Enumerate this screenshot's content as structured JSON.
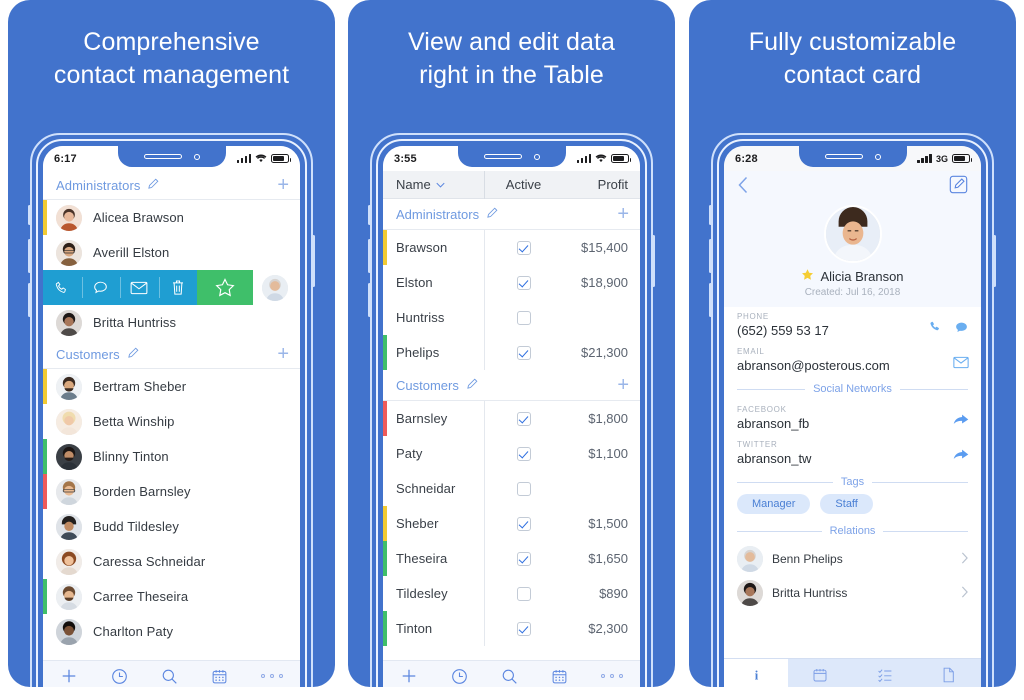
{
  "theme": {
    "panel_blue": "#4273cc",
    "accent_blue": "#4a7fd4",
    "swipe_blue": "#1f9ed2",
    "swipe_green": "#3fbf6a",
    "strip_yellow": "#f2cb33",
    "strip_green": "#3fbf6a",
    "strip_red": "#ee5a5a"
  },
  "panels": [
    {
      "id": "panel-1",
      "headline": "Comprehensive\ncontact management",
      "headline_line1": "Comprehensive",
      "headline_line2": "contact management",
      "status": {
        "time": "6:17",
        "carrier": "",
        "wifi": true
      },
      "groups": [
        {
          "label": "Administrators",
          "edit_icon": "pencil-icon",
          "add_icon": "plus-icon"
        },
        {
          "label": "Customers",
          "edit_icon": "pencil-icon",
          "add_icon": "plus-icon"
        }
      ],
      "contacts_admins": [
        {
          "name": "Alicea Brawson",
          "strip": "#f2cb33",
          "avatar": "woman-1"
        },
        {
          "name": "Averill Elston",
          "strip": "",
          "avatar": "woman-glasses"
        },
        {
          "name": "Britta Huntriss",
          "strip": "",
          "avatar": "woman-2"
        }
      ],
      "swipe_row": {
        "actions": [
          "phone-icon",
          "chat-icon",
          "mail-icon",
          "trash-icon",
          "star-icon"
        ],
        "avatar": "man-senior"
      },
      "contacts_customers": [
        {
          "name": "Bertram Sheber",
          "strip": "#f2cb33",
          "avatar": "man-beard"
        },
        {
          "name": "Betta Winship",
          "strip": "",
          "avatar": "woman-blonde"
        },
        {
          "name": "Blinny Tinton",
          "strip": "#3fbf6a",
          "avatar": "man-dark"
        },
        {
          "name": "Borden Barnsley",
          "strip": "#ee5a5a",
          "avatar": "man-glasses"
        },
        {
          "name": "Budd Tildesley",
          "strip": "",
          "avatar": "man-cap"
        },
        {
          "name": "Caressa Schneidar",
          "strip": "",
          "avatar": "woman-red"
        },
        {
          "name": "Carree Theseira",
          "strip": "#3fbf6a",
          "avatar": "man-young"
        },
        {
          "name": "Charlton Paty",
          "strip": "",
          "avatar": "man-dark2"
        }
      ],
      "toolbar": [
        "plus-icon",
        "recent-clock-icon",
        "search-icon",
        "calendar-icon",
        "more-dots-icon"
      ]
    },
    {
      "id": "panel-2",
      "headline_line1": "View and edit data",
      "headline_line2": "right in the Table",
      "status": {
        "time": "3:55",
        "carrier": "",
        "wifi": true
      },
      "toolbar": [
        "plus-icon",
        "recent-clock-icon",
        "search-icon",
        "calendar-icon",
        "more-dots-icon"
      ]
    },
    {
      "id": "panel-3",
      "headline_line1": "Fully customizable",
      "headline_line2": "contact card",
      "status": {
        "time": "6:28",
        "carrier": "3G",
        "wifi": false
      },
      "nav": {
        "back_icon": "chevron-left-icon",
        "edit_icon": "edit-square-icon"
      },
      "hero": {
        "avatar": "woman-portrait",
        "favorite_icon": "star-icon",
        "name": "Alicia Branson",
        "created": "Created:  Jul 16, 2018"
      },
      "fields": [
        {
          "label": "PHONE",
          "value": "(652) 559 53 17",
          "icons": [
            "phone-icon",
            "chat-icon"
          ]
        },
        {
          "label": "EMAIL",
          "value": "abranson@posterous.com",
          "icons": [
            "mail-icon"
          ]
        }
      ],
      "section_social": "Social Networks",
      "social": [
        {
          "label": "FACEBOOK",
          "value": "abranson_fb",
          "icons": [
            "share-arrow-icon"
          ]
        },
        {
          "label": "TWITTER",
          "value": "abranson_tw",
          "icons": [
            "share-arrow-icon"
          ]
        }
      ],
      "section_tags": "Tags",
      "tags": [
        "Manager",
        "Staff"
      ],
      "section_relations": "Relations",
      "relations": [
        {
          "name": "Benn Phelips",
          "avatar": "man-senior",
          "chev": "chevron-right-icon"
        },
        {
          "name": "Britta Huntriss",
          "avatar": "woman-2",
          "chev": "chevron-right-icon"
        }
      ],
      "tabs": [
        {
          "icon": "info-icon",
          "active": true
        },
        {
          "icon": "calendar-icon",
          "active": false
        },
        {
          "icon": "checklist-icon",
          "active": false
        },
        {
          "icon": "document-icon",
          "active": false
        }
      ]
    }
  ],
  "chart_data": {
    "type": "table",
    "title": "Contacts table",
    "columns": [
      "Name",
      "Active",
      "Profit"
    ],
    "sort_column": "Name",
    "sort_icon": "chevron-down-icon",
    "groups": [
      {
        "label": "Administrators",
        "rows": [
          {
            "name": "Brawson",
            "active": true,
            "profit": "$15,400",
            "strip": "#f2cb33"
          },
          {
            "name": "Elston",
            "active": true,
            "profit": "$18,900",
            "strip": ""
          },
          {
            "name": "Huntriss",
            "active": false,
            "profit": "",
            "strip": ""
          },
          {
            "name": "Phelips",
            "active": true,
            "profit": "$21,300",
            "strip": "#3fbf6a"
          }
        ]
      },
      {
        "label": "Customers",
        "rows": [
          {
            "name": "Barnsley",
            "active": true,
            "profit": "$1,800",
            "strip": "#ee5a5a"
          },
          {
            "name": "Paty",
            "active": true,
            "profit": "$1,100",
            "strip": ""
          },
          {
            "name": "Schneidar",
            "active": false,
            "profit": "",
            "strip": ""
          },
          {
            "name": "Sheber",
            "active": true,
            "profit": "$1,500",
            "strip": "#f2cb33"
          },
          {
            "name": "Theseira",
            "active": true,
            "profit": "$1,650",
            "strip": "#3fbf6a"
          },
          {
            "name": "Tildesley",
            "active": false,
            "profit": "$890",
            "strip": ""
          },
          {
            "name": "Tinton",
            "active": true,
            "profit": "$2,300",
            "strip": "#3fbf6a"
          }
        ]
      }
    ]
  }
}
